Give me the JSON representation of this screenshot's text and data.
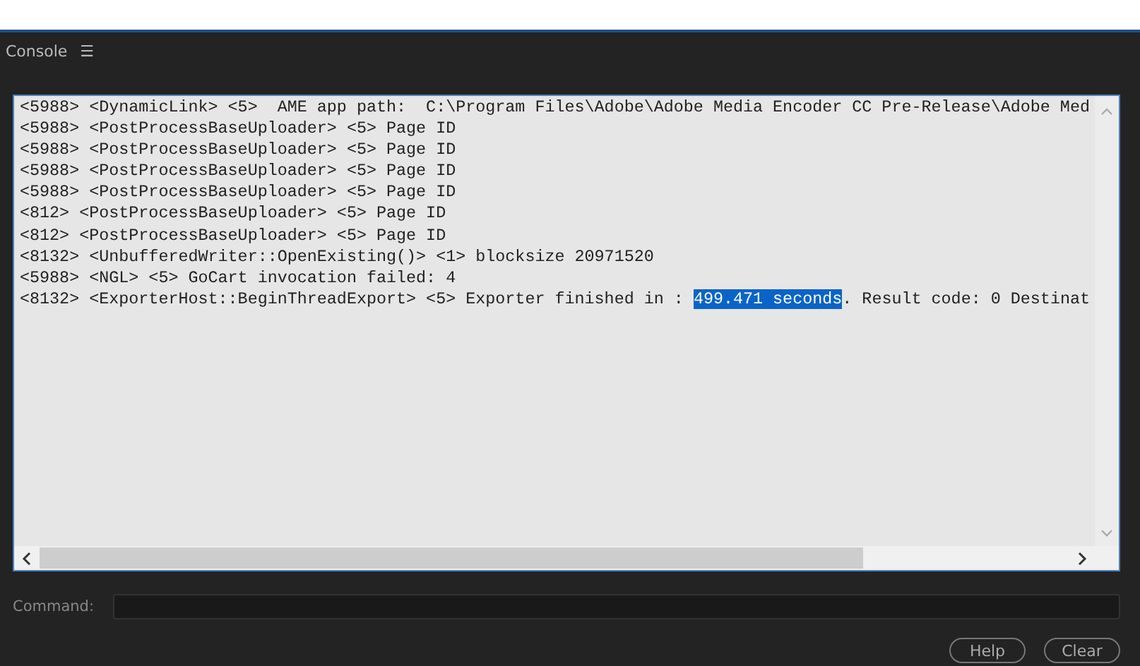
{
  "panel": {
    "title": "Console",
    "menu_glyph": "☰"
  },
  "log": [
    {
      "segments": [
        {
          "text": "<5988> <DynamicLink> <5>  AME app path:  C:\\Program Files\\Adobe\\Adobe Media Encoder CC Pre-Release\\Adobe Med",
          "selected": false
        }
      ]
    },
    {
      "segments": [
        {
          "text": "<5988> <PostProcessBaseUploader> <5> Page ID",
          "selected": false
        }
      ]
    },
    {
      "segments": [
        {
          "text": "<5988> <PostProcessBaseUploader> <5> Page ID",
          "selected": false
        }
      ]
    },
    {
      "segments": [
        {
          "text": "<5988> <PostProcessBaseUploader> <5> Page ID",
          "selected": false
        }
      ]
    },
    {
      "segments": [
        {
          "text": "<5988> <PostProcessBaseUploader> <5> Page ID",
          "selected": false
        }
      ]
    },
    {
      "segments": [
        {
          "text": "<812> <PostProcessBaseUploader> <5> Page ID",
          "selected": false
        }
      ]
    },
    {
      "segments": [
        {
          "text": "<812> <PostProcessBaseUploader> <5> Page ID",
          "selected": false
        }
      ]
    },
    {
      "segments": [
        {
          "text": "<8132> <UnbufferedWriter::OpenExisting()> <1> blocksize 20971520",
          "selected": false
        }
      ]
    },
    {
      "segments": [
        {
          "text": "<5988> <NGL> <5> GoCart invocation failed: 4",
          "selected": false
        }
      ]
    },
    {
      "segments": [
        {
          "text": "<8132> <ExporterHost::BeginThreadExport> <5> Exporter finished in : ",
          "selected": false
        },
        {
          "text": "499.471 seconds",
          "selected": true
        },
        {
          "text": ". Result code: 0 Destinat",
          "selected": false
        }
      ]
    }
  ],
  "command": {
    "label": "Command:"
  },
  "buttons": [
    "Help",
    "Clear"
  ]
}
